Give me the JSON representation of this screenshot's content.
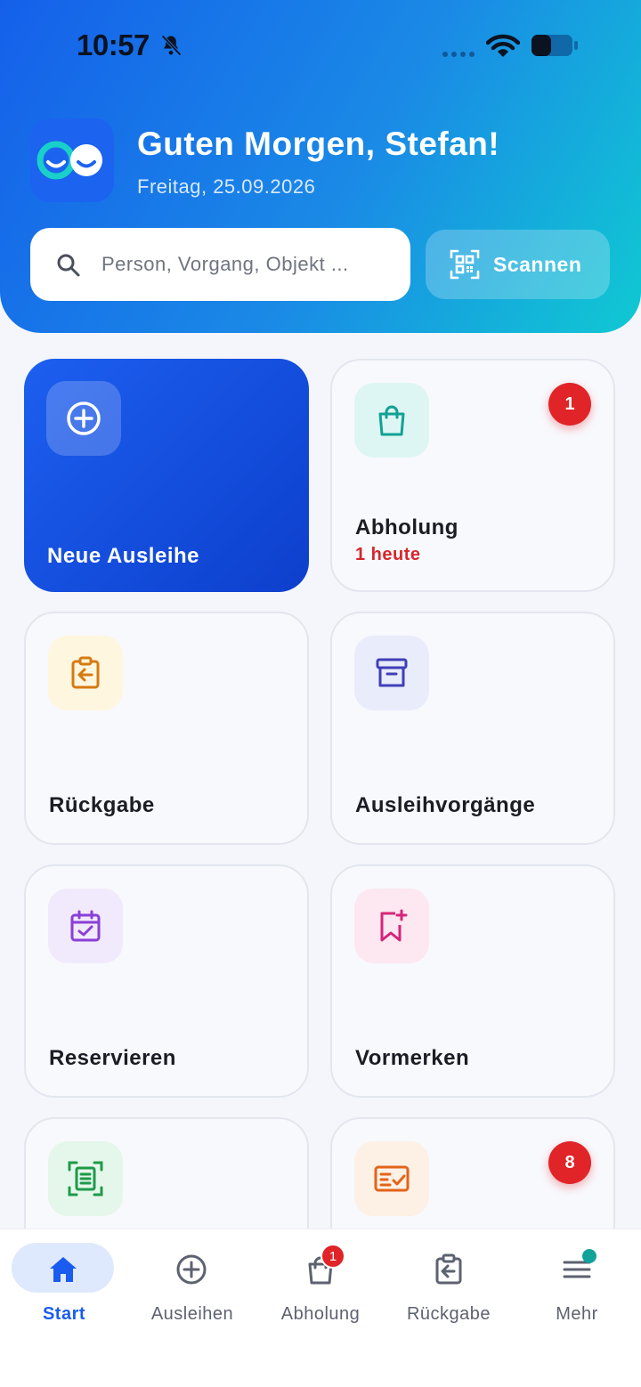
{
  "status_bar": {
    "time": "10:57"
  },
  "header": {
    "greeting": "Guten Morgen, Stefan!",
    "date": "Freitag, 25.09.2026"
  },
  "search": {
    "placeholder": "Person, Vorgang, Objekt ..."
  },
  "scan": {
    "label": "Scannen"
  },
  "tiles": [
    {
      "label": "Neue Ausleihe",
      "icon": "plus-circle-icon"
    },
    {
      "label": "Abholung",
      "sub": "1 heute",
      "badge": "1",
      "icon": "shopping-bag-icon"
    },
    {
      "label": "Rückgabe",
      "icon": "clipboard-return-icon"
    },
    {
      "label": "Ausleihvorgänge",
      "icon": "archive-box-icon"
    },
    {
      "label": "Reservieren",
      "icon": "calendar-check-icon"
    },
    {
      "label": "Vormerken",
      "icon": "bookmark-plus-icon"
    },
    {
      "label": "",
      "icon": "document-scan-icon"
    },
    {
      "label": "",
      "badge": "8",
      "icon": "checklist-icon"
    }
  ],
  "colors": {
    "accent": "#1a5cf0",
    "badge": "#e02428",
    "pickup_icon": "#12a195",
    "return_icon": "#d67a10",
    "archive_icon": "#3f3fb8",
    "calendar_icon": "#8a3fd6",
    "bookmark_icon": "#d6257a",
    "scan_doc_icon": "#1e9a4a",
    "checklist_icon": "#e2641a"
  },
  "nav": {
    "items": [
      {
        "label": "Start",
        "icon": "home-icon",
        "active": true
      },
      {
        "label": "Ausleihen",
        "icon": "plus-circle-icon"
      },
      {
        "label": "Abholung",
        "icon": "shopping-bag-icon",
        "badge": "1"
      },
      {
        "label": "Rückgabe",
        "icon": "clipboard-return-icon"
      },
      {
        "label": "Mehr",
        "icon": "menu-icon",
        "dot": true
      }
    ]
  }
}
